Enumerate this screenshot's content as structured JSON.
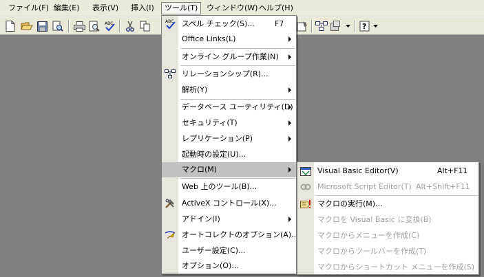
{
  "menubar": {
    "items": [
      {
        "label": "ファイル(F)"
      },
      {
        "label": "編集(E)"
      },
      {
        "label": "表示(V)"
      },
      {
        "label": "挿入(I)"
      },
      {
        "label": "ツール(T)"
      },
      {
        "label": "ウィンドウ(W)"
      },
      {
        "label": "ヘルプ(H)"
      }
    ]
  },
  "toolbar": {
    "icons": [
      "new-icon",
      "open-icon",
      "save-icon",
      "search-file-icon",
      "print-icon",
      "print-preview-icon",
      "spelling-icon",
      "cut-icon",
      "copy-icon"
    ],
    "right_icons": [
      "properties-icon",
      "relationships-icon",
      "new-object-icon",
      "help-icon"
    ]
  },
  "tools_menu": {
    "items": [
      {
        "label": "スペル チェック(S)...",
        "accel": "F7",
        "icon": "spell-check-icon"
      },
      {
        "label": "Office Links(L)",
        "submenu": true
      },
      {
        "label": "オンライン グループ作業(N)",
        "submenu": true
      },
      {
        "label": "リレーションシップ(R)...",
        "icon": "relationships-icon"
      },
      {
        "label": "解析(Y)",
        "submenu": true
      },
      {
        "label": "データベース ユーティリティ(D)",
        "submenu": true
      },
      {
        "label": "セキュリティ(T)",
        "submenu": true
      },
      {
        "label": "レプリケーション(P)",
        "submenu": true
      },
      {
        "label": "起動時の設定(U)..."
      },
      {
        "label": "マクロ(M)",
        "submenu": true,
        "selected": true
      },
      {
        "label": "Web 上のツール(B)..."
      },
      {
        "label": "ActiveX コントロール(X)...",
        "icon": "activex-icon"
      },
      {
        "label": "アドイン(I)",
        "submenu": true
      },
      {
        "label": "オートコレクトのオプション(A)...",
        "icon": "autocorrect-icon"
      },
      {
        "label": "ユーザー設定(C)..."
      },
      {
        "label": "オプション(O)..."
      }
    ]
  },
  "macro_submenu": {
    "items": [
      {
        "label": "Visual Basic Editor(V)",
        "accel": "Alt+F11",
        "icon": "vbe-icon"
      },
      {
        "label": "Microsoft Script Editor(T)",
        "accel": "Alt+Shift+F11",
        "icon": "script-editor-icon",
        "disabled": true
      },
      {
        "label": "マクロの実行(M)...",
        "icon": "run-macro-icon"
      },
      {
        "label": "マクロを Visual Basic に変換(B)",
        "disabled": true
      },
      {
        "label": "マクロからメニューを作成(C)",
        "disabled": true
      },
      {
        "label": "マクロからツールバーを作成(T)",
        "disabled": true
      },
      {
        "label": "マクロからショートカット メニューを作成(S)",
        "disabled": true
      }
    ]
  }
}
